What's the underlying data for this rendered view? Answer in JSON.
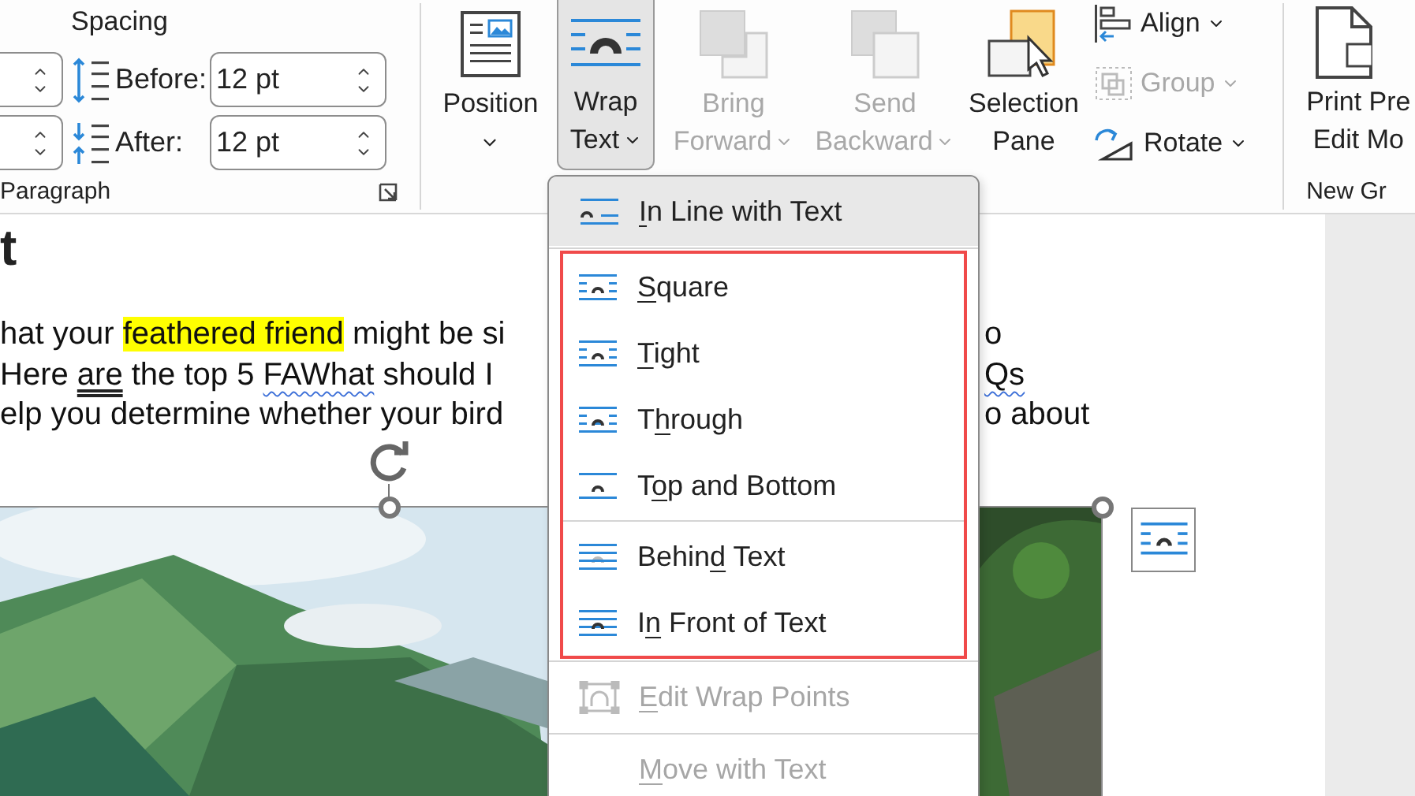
{
  "paragraph_group": {
    "heading": "Spacing",
    "rows": [
      {
        "kind": "before",
        "label": "Before:",
        "value": "12 pt"
      },
      {
        "kind": "after",
        "label": "After:",
        "value": "12 pt"
      }
    ],
    "label": "Paragraph"
  },
  "arrange_buttons": [
    {
      "kind": "position",
      "lines": [
        "Position"
      ],
      "dropdown": true,
      "selected": false,
      "disabled": false
    },
    {
      "kind": "wrap",
      "lines": [
        "Wrap",
        "Text"
      ],
      "dropdown": true,
      "selected": true,
      "disabled": false
    },
    {
      "kind": "forward",
      "lines": [
        "Bring",
        "Forward"
      ],
      "dropdown": true,
      "selected": false,
      "disabled": true
    },
    {
      "kind": "backward",
      "lines": [
        "Send",
        "Backward"
      ],
      "dropdown": true,
      "selected": false,
      "disabled": true
    },
    {
      "kind": "pane",
      "lines": [
        "Selection",
        "Pane"
      ],
      "dropdown": false,
      "selected": false,
      "disabled": false
    }
  ],
  "small_buttons": [
    {
      "kind": "align",
      "label": "Align",
      "disabled": false
    },
    {
      "kind": "group",
      "label": "Group",
      "disabled": true
    },
    {
      "kind": "rotate",
      "label": "Rotate",
      "disabled": false
    }
  ],
  "next_group": {
    "lines": [
      "Print Pre",
      "Edit Mo"
    ],
    "label": "New Gr"
  },
  "document": {
    "heading": "t",
    "lines": [
      {
        "left": [
          {
            "kind": "plain",
            "text": "hat your "
          },
          {
            "kind": "highlight",
            "text": "feathered friend"
          },
          {
            "kind": "plain",
            "text": " might be si"
          }
        ],
        "right": [
          {
            "kind": "plain",
            "text": "o"
          }
        ]
      },
      {
        "left": [
          {
            "kind": "plain",
            "text": "Here "
          },
          {
            "kind": "double",
            "text": "are"
          },
          {
            "kind": "plain",
            "text": " the top 5 "
          },
          {
            "kind": "wavy",
            "text": "FAWhat"
          },
          {
            "kind": "plain",
            "text": " should I"
          }
        ],
        "right": [
          {
            "kind": "wavy",
            "text": "Qs"
          }
        ]
      },
      {
        "left": [
          {
            "kind": "plain",
            "text": "elp you determine whether your bird"
          }
        ],
        "right": [
          {
            "kind": "plain",
            "text": "o about"
          }
        ]
      }
    ]
  },
  "menu": {
    "items": [
      {
        "kind": "inline",
        "label": {
          "key": "I",
          "post": "n Line with Text"
        },
        "selected": true,
        "disabled": false,
        "framed": false
      },
      {
        "kind": "separator",
        "framed": false
      },
      {
        "kind": "square",
        "label": {
          "key": "S",
          "post": "quare"
        },
        "selected": false,
        "disabled": false,
        "framed": true
      },
      {
        "kind": "tight",
        "label": {
          "key": "T",
          "post": "ight"
        },
        "selected": false,
        "disabled": false,
        "framed": true
      },
      {
        "kind": "through",
        "label": {
          "pre": "T",
          "key": "h",
          "post": "rough"
        },
        "selected": false,
        "disabled": false,
        "framed": true
      },
      {
        "kind": "topbottom",
        "label": {
          "pre": "T",
          "key": "o",
          "post": "p and Bottom"
        },
        "selected": false,
        "disabled": false,
        "framed": true
      },
      {
        "kind": "separator",
        "framed": true
      },
      {
        "kind": "behind",
        "label": {
          "pre": "Behin",
          "key": "d",
          "post": " Text"
        },
        "selected": false,
        "disabled": false,
        "framed": true
      },
      {
        "kind": "front",
        "label": {
          "pre": "I",
          "key": "n",
          "post": " Front of Text"
        },
        "selected": false,
        "disabled": false,
        "framed": true
      },
      {
        "kind": "separator",
        "framed": false
      },
      {
        "kind": "editpoints",
        "label": {
          "key": "E",
          "post": "dit Wrap Points"
        },
        "selected": false,
        "disabled": true,
        "framed": false
      },
      {
        "kind": "separator",
        "framed": false
      },
      {
        "kind": "move",
        "label": {
          "key": "M",
          "post": "ove with Text"
        },
        "selected": false,
        "disabled": true,
        "framed": false
      }
    ]
  }
}
